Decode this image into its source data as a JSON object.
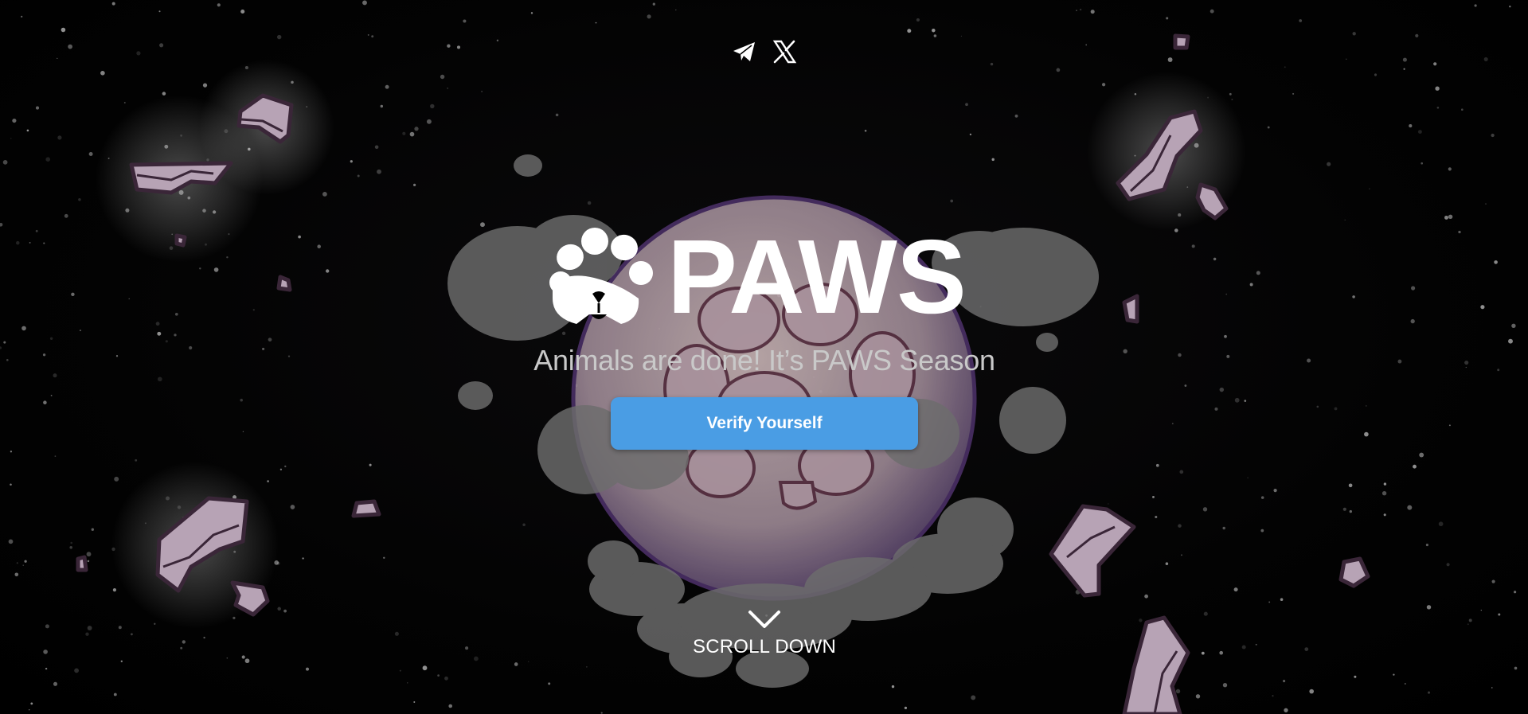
{
  "header": {
    "social_links": [
      {
        "icon": "telegram-icon"
      },
      {
        "icon": "x-icon"
      }
    ]
  },
  "hero": {
    "title": "PAWS",
    "tagline": "Animals are done! It’s PAWS Season",
    "verify_label": "Verify Yourself",
    "scroll_label": "SCROLL DOWN"
  },
  "colors": {
    "background": "#020202",
    "accent": "#4a9de4",
    "rock": "#b7a3b5",
    "rock_outline": "#3a2638",
    "smoke": "#6a6a6a",
    "planet": "#b49ea6"
  }
}
